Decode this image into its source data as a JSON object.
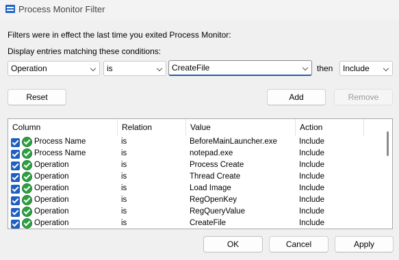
{
  "window": {
    "title": "Process Monitor Filter",
    "icon": "process-monitor-icon"
  },
  "info_text": "Filters were in effect the last time you exited Process Monitor:",
  "conditions_label": "Display entries matching these conditions:",
  "condition": {
    "column": "Operation",
    "relation": "is",
    "value": "CreateFile",
    "then_label": "then",
    "action": "Include"
  },
  "buttons": {
    "reset": "Reset",
    "add": "Add",
    "remove": "Remove",
    "ok": "OK",
    "cancel": "Cancel",
    "apply": "Apply"
  },
  "table": {
    "headers": [
      "Column",
      "Relation",
      "Value",
      "Action"
    ],
    "rows": [
      {
        "column": "Process Name",
        "relation": "is",
        "value": "BeforeMainLauncher.exe",
        "action": "Include"
      },
      {
        "column": "Process Name",
        "relation": "is",
        "value": "notepad.exe",
        "action": "Include"
      },
      {
        "column": "Operation",
        "relation": "is",
        "value": "Process Create",
        "action": "Include"
      },
      {
        "column": "Operation",
        "relation": "is",
        "value": "Thread Create",
        "action": "Include"
      },
      {
        "column": "Operation",
        "relation": "is",
        "value": "Load Image",
        "action": "Include"
      },
      {
        "column": "Operation",
        "relation": "is",
        "value": "RegOpenKey",
        "action": "Include"
      },
      {
        "column": "Operation",
        "relation": "is",
        "value": "RegQueryValue",
        "action": "Include"
      },
      {
        "column": "Operation",
        "relation": "is",
        "value": "CreateFile",
        "action": "Include"
      }
    ]
  },
  "colors": {
    "accent": "#1f5fbf",
    "include_icon": "#2ea043",
    "background": "#f0f0f0"
  }
}
